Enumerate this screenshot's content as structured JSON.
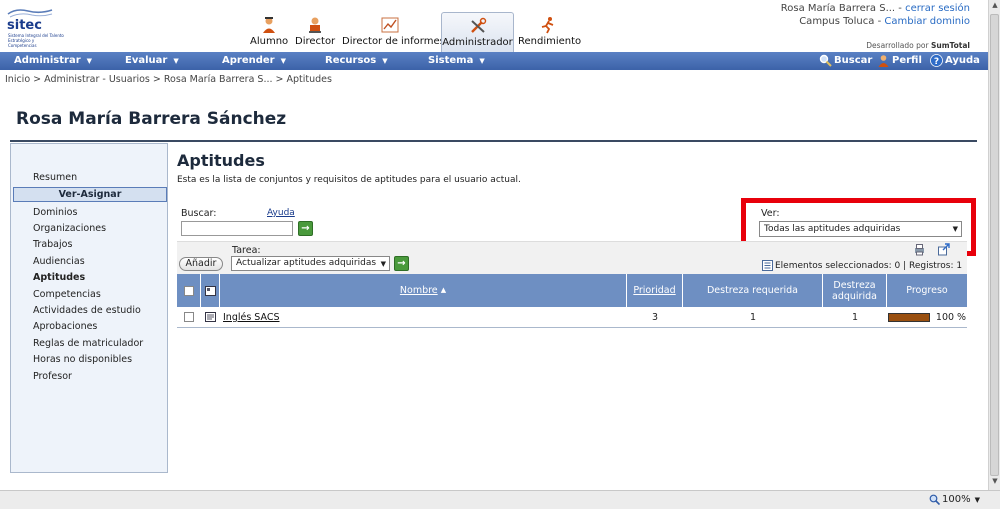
{
  "logo": {
    "name": "sitec",
    "tagline": "Sistema Integral del Talento Estratégico y Competencias"
  },
  "roles": [
    {
      "label": "Alumno",
      "icon": "student-icon"
    },
    {
      "label": "Director",
      "icon": "director-icon"
    },
    {
      "label": "Director de informes",
      "icon": "report-chart-icon"
    },
    {
      "label": "Administrador",
      "icon": "admin-tools-icon",
      "active": true
    },
    {
      "label": "Rendimiento",
      "icon": "runner-icon"
    }
  ],
  "user": {
    "name": "Rosa María Barrera S...",
    "separator": " - ",
    "logout": "cerrar sesión",
    "campus": "Campus Toluca",
    "change_domain": "Cambiar dominio"
  },
  "developed_by": {
    "prefix": "Desarrollado por",
    "brand": "SumTotal"
  },
  "menu": [
    {
      "label": "Administrar"
    },
    {
      "label": "Evaluar"
    },
    {
      "label": "Aprender"
    },
    {
      "label": "Recursos"
    },
    {
      "label": "Sistema"
    }
  ],
  "menu_right": [
    {
      "label": "Buscar",
      "icon": "search-icon"
    },
    {
      "label": "Perfil",
      "icon": "profile-icon"
    },
    {
      "label": "Ayuda",
      "icon": "help-icon"
    }
  ],
  "breadcrumb": "Inicio > Administrar - Usuarios > Rosa María Barrera S... > Aptitudes",
  "page_title": "Rosa María Barrera Sánchez",
  "sidebar": {
    "resumen": "Resumen",
    "active": "Ver-Asignar",
    "items": [
      "Dominios",
      "Organizaciones",
      "Trabajos",
      "Audiencias",
      "Aptitudes",
      "Competencias",
      "Actividades de estudio",
      "Aprobaciones",
      "Reglas de matriculador",
      "Horas no disponibles",
      "Profesor"
    ]
  },
  "main": {
    "heading": "Aptitudes",
    "description": "Esta es la lista de conjuntos y requisitos de aptitudes para el usuario actual.",
    "search_label": "Buscar:",
    "help_link": "Ayuda",
    "search_value": "",
    "ver_label": "Ver:",
    "ver_value": "Todas las aptitudes adquiridas",
    "task_label": "Tarea:",
    "add_button": "Añadir",
    "task_value": "Actualizar aptitudes adquiridas",
    "selection_info": "Elementos seleccionados: 0 | Registros: 1",
    "go": "→"
  },
  "table": {
    "columns": [
      "Nombre",
      "Prioridad",
      "Destreza requerida",
      "Destreza adquirida",
      "Progreso"
    ],
    "sort_indicator": "▲",
    "rows": [
      {
        "name": "Inglés SACS",
        "priority": "3",
        "required": "1",
        "acquired": "1",
        "progress": "100 %",
        "progress_value": 100
      }
    ]
  },
  "status": {
    "zoom": "100%"
  },
  "colors": {
    "menu": "#3c62a8",
    "table_header": "#6e8fc2",
    "highlight": "#e8000b",
    "progress": "#9a5010"
  }
}
